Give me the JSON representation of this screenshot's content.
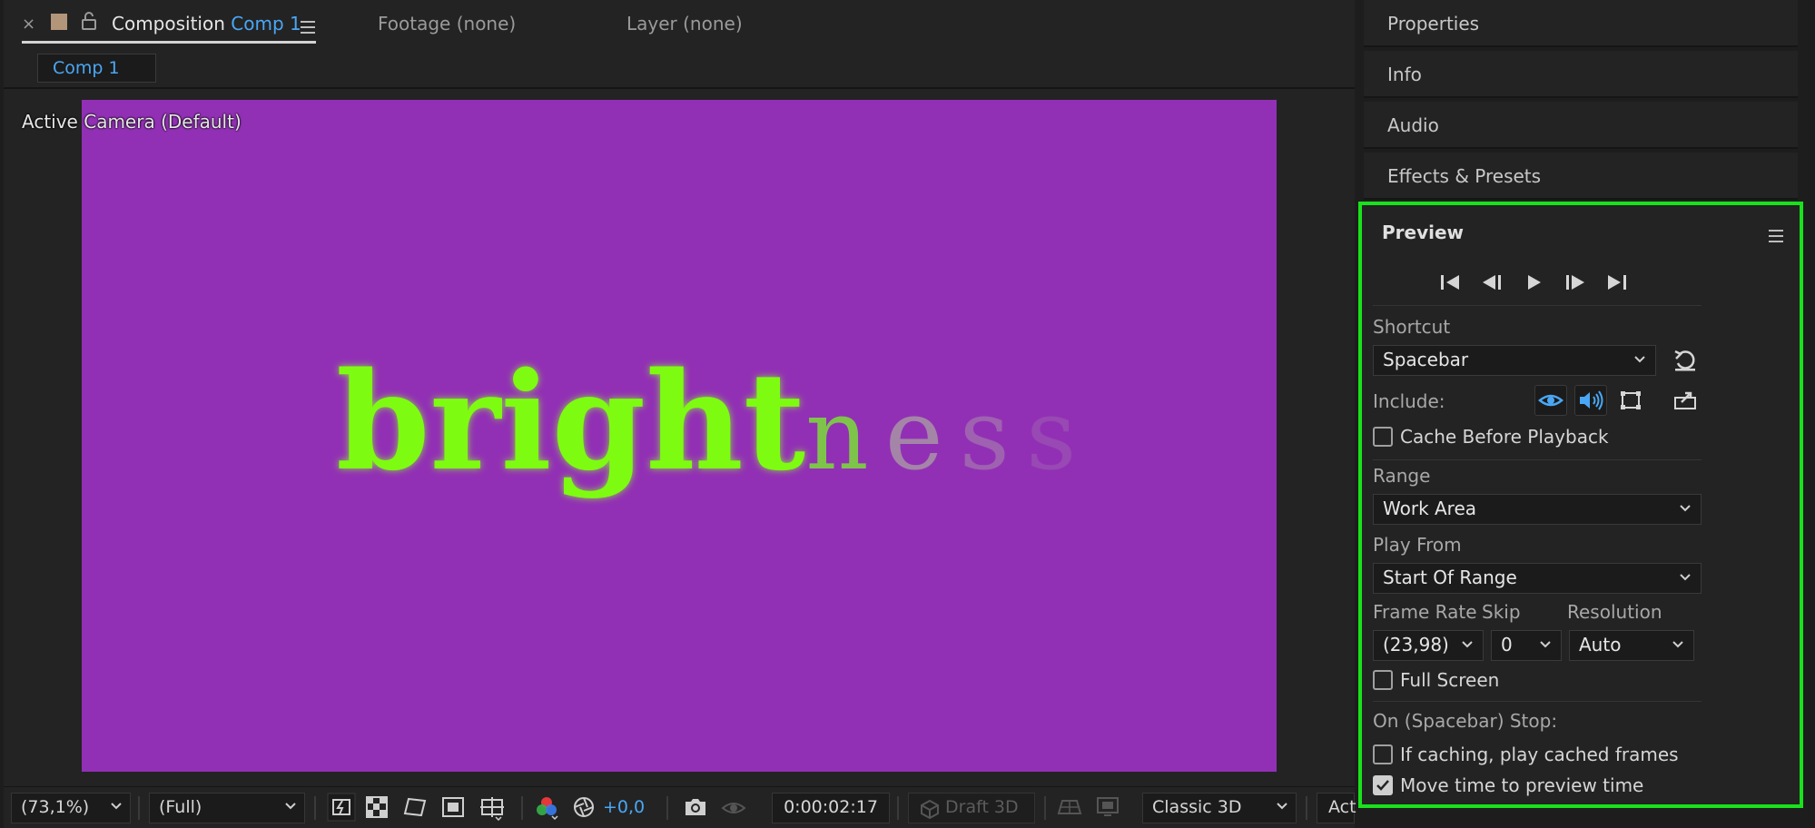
{
  "composition_panel": {
    "tabs": {
      "close": "×",
      "composition_label": "Composition",
      "composition_name": "Comp 1",
      "footage": "Footage (none)",
      "layer": "Layer (none)"
    },
    "comp_chip": "Comp 1",
    "viewer": {
      "camera_label": "Active Camera (Default)",
      "canvas_color": "#9230b5",
      "text_solid": "bright",
      "text_fade_letters": [
        "n",
        "e",
        "s",
        "s"
      ],
      "text_color": "#7dfc11"
    },
    "toolbar": {
      "zoom": "(73,1%)",
      "resolution": "(Full)",
      "exposure": "+0,0",
      "timecode": "0:00:02:17",
      "draft3d": "Draft 3D",
      "renderer": "Classic 3D",
      "view_truncated": "Act"
    }
  },
  "right_panels": {
    "collapsed": [
      "Properties",
      "Info",
      "Audio",
      "Effects & Presets"
    ]
  },
  "preview": {
    "title": "Preview",
    "shortcut_label": "Shortcut",
    "shortcut_value": "Spacebar",
    "include_label": "Include:",
    "cache_before_playback": {
      "label": "Cache Before Playback",
      "checked": false
    },
    "range_label": "Range",
    "range_value": "Work Area",
    "play_from_label": "Play From",
    "play_from_value": "Start Of Range",
    "frame_rate_label": "Frame Rate",
    "frame_rate_value": "(23,98)",
    "skip_label": "Skip",
    "skip_value": "0",
    "resolution_label": "Resolution",
    "resolution_value": "Auto",
    "full_screen": {
      "label": "Full Screen",
      "checked": false
    },
    "on_stop_label": "On (Spacebar) Stop:",
    "if_caching": {
      "label": "If caching, play cached frames",
      "checked": false
    },
    "move_time": {
      "label": "Move time to preview time",
      "checked": true
    },
    "highlight_color": "#19e11c",
    "accent_color": "#4aa7f5"
  }
}
